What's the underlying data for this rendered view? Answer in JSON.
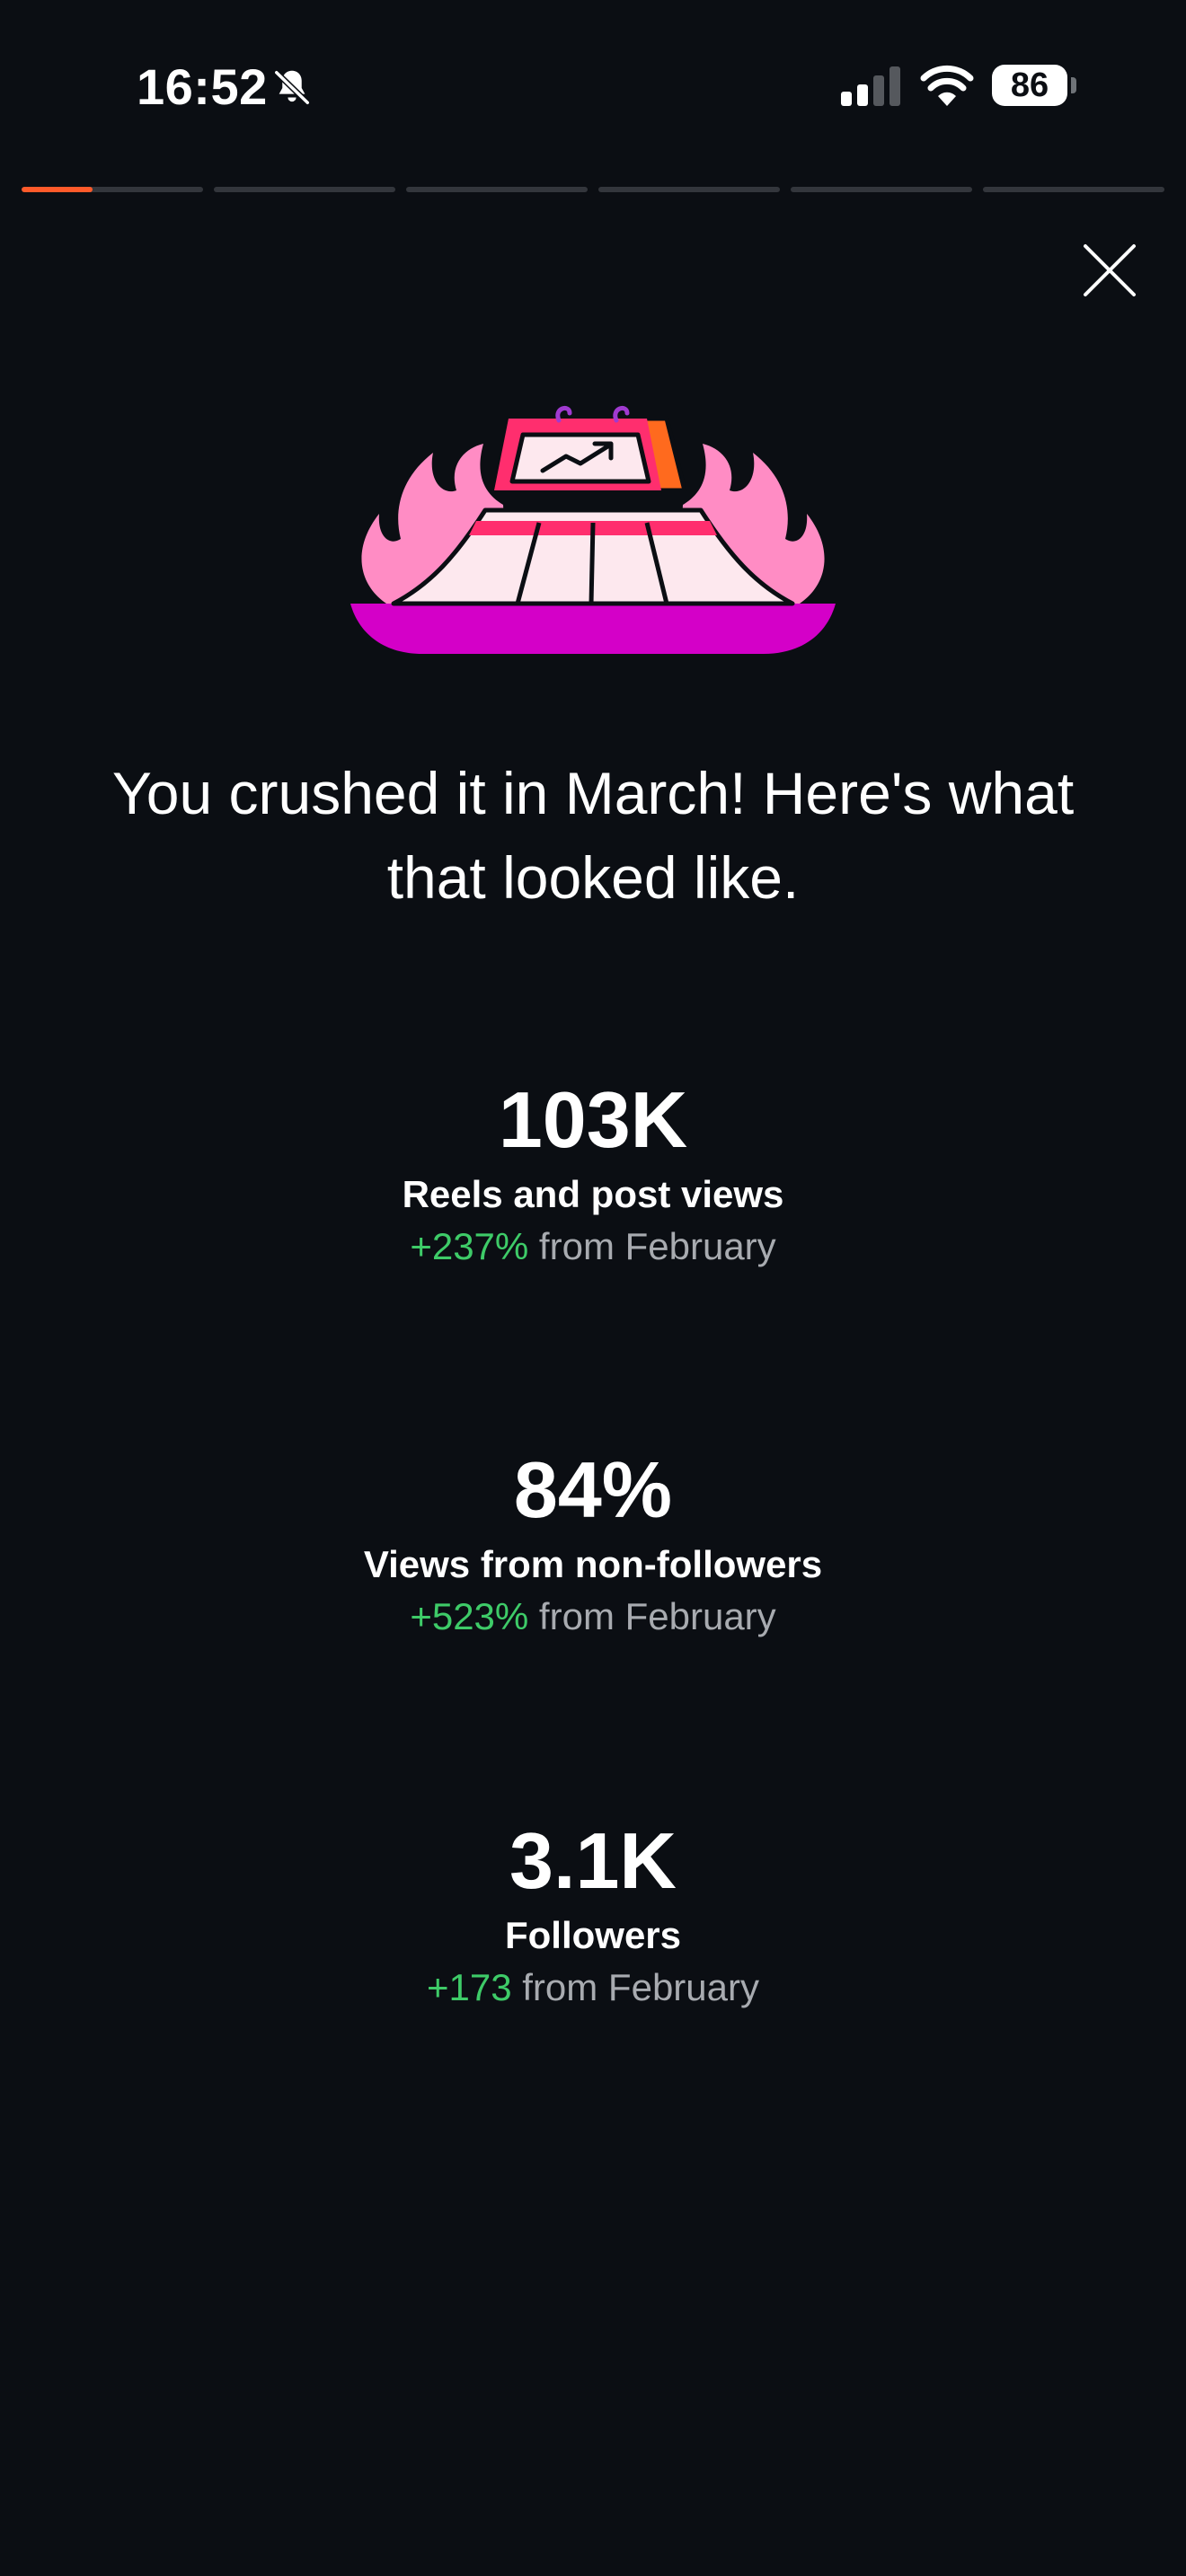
{
  "status_bar": {
    "time": "16:52",
    "battery": "86",
    "icons": [
      "bell-slash-icon",
      "signal-icon",
      "wifi-icon",
      "battery-icon"
    ]
  },
  "story_progress": {
    "segments": 6,
    "current_index": 0,
    "current_fill_fraction": 0.39,
    "active_color": "#ff5a2a",
    "inactive_color": "#33363c"
  },
  "close_icon": "close-icon",
  "hero_icon": "trending-chart-podium-flames-icon",
  "headline": "You crushed it in March! Here's what that looked like.",
  "stats": [
    {
      "value": "103K",
      "label": "Reels and post views",
      "delta": "+237%",
      "suffix": " from February"
    },
    {
      "value": "84%",
      "label": "Views from non-followers",
      "delta": "+523%",
      "suffix": " from February"
    },
    {
      "value": "3.1K",
      "label": "Followers",
      "delta": "+173",
      "suffix": " from February"
    }
  ],
  "colors": {
    "background": "#0b0e13",
    "positive_delta": "#3ecb68",
    "muted_text": "#a8abb0",
    "flame_pink": "#ff8cc4",
    "tray_magenta": "#d400c8",
    "accent_red": "#ff2e6e",
    "accent_orange": "#ff6a1e"
  }
}
